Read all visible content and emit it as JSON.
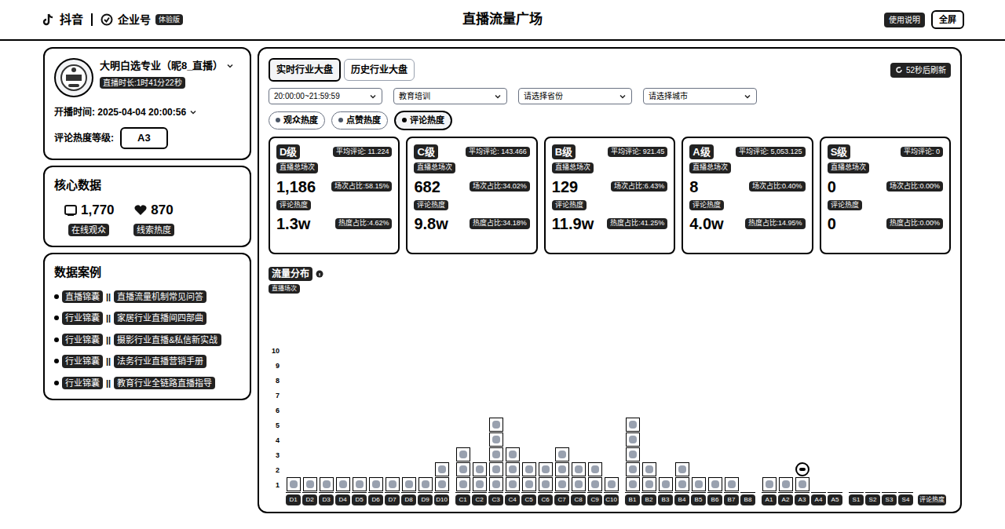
{
  "header": {
    "logo": "抖音",
    "brand": "企业号",
    "badge": "体验版",
    "title": "直播流量广场",
    "help": "使用说明",
    "fullscreen": "全屏"
  },
  "profile": {
    "name": "大明白选专业（昵8_直播）",
    "duration": "直播时长:1时41分22秒",
    "start": "开播时间: 2025-04-04 20:00:56",
    "level_label": "评论热度等级:",
    "level": "A3"
  },
  "core": {
    "title": "核心数据",
    "metrics": [
      {
        "value": "1,770",
        "label": "在线观众"
      },
      {
        "value": "870",
        "label": "线索热度"
      }
    ]
  },
  "cases": {
    "title": "数据案例",
    "items": [
      {
        "tag": "直播锦囊",
        "sep": "||",
        "text": "直播流量机制常见问答"
      },
      {
        "tag": "行业锦囊",
        "sep": "||",
        "text": "家居行业直播间四部曲"
      },
      {
        "tag": "行业锦囊",
        "sep": "||",
        "text": "摄影行业直播&私信新实战"
      },
      {
        "tag": "行业锦囊",
        "sep": "||",
        "text": "法务行业直播营销手册"
      },
      {
        "tag": "行业锦囊",
        "sep": "||",
        "text": "教育行业全链路直播指导"
      }
    ]
  },
  "main": {
    "tabs": [
      {
        "label": "实时行业大盘",
        "selected": true
      },
      {
        "label": "历史行业大盘",
        "selected": false
      }
    ],
    "refresh": "52秒后刷新",
    "filters": [
      "20:00:00~21:59:59",
      "教育培训",
      "请选择省份",
      "请选择城市"
    ],
    "metrics": [
      {
        "label": "观众热度",
        "selected": false
      },
      {
        "label": "点赞热度",
        "selected": false
      },
      {
        "label": "评论热度",
        "selected": true
      }
    ],
    "levels": [
      {
        "name": "D级",
        "avg": "平均评论: 11.224",
        "count_label": "直播总场次",
        "count": "1,186",
        "count_share": "场次占比:58.15%",
        "heat_label": "评论热度",
        "heat": "1.3w",
        "heat_share": "热度占比:4.62%"
      },
      {
        "name": "C级",
        "avg": "平均评论: 143.466",
        "count_label": "直播总场次",
        "count": "682",
        "count_share": "场次占比:34.02%",
        "heat_label": "评论热度",
        "heat": "9.8w",
        "heat_share": "热度占比:34.18%"
      },
      {
        "name": "B级",
        "avg": "平均评论: 921.45",
        "count_label": "直播总场次",
        "count": "129",
        "count_share": "场次占比:6.43%",
        "heat_label": "评论热度",
        "heat": "11.9w",
        "heat_share": "热度占比:41.25%"
      },
      {
        "name": "A级",
        "avg": "平均评论: 5,053.125",
        "count_label": "直播总场次",
        "count": "8",
        "count_share": "场次占比:0.40%",
        "heat_label": "评论热度",
        "heat": "4.0w",
        "heat_share": "热度占比:14.95%"
      },
      {
        "name": "S级",
        "avg": "平均评论: 0",
        "count_label": "直播总场次",
        "count": "0",
        "count_share": "场次占比:0.00%",
        "heat_label": "评论热度",
        "heat": "0",
        "heat_share": "热度占比:0.00%"
      }
    ]
  },
  "chart": {
    "title": "流量分布",
    "y_label": "直播场次",
    "y_ticks": [
      "10",
      "9",
      "8",
      "7",
      "6",
      "5",
      "4",
      "3",
      "2",
      "1"
    ],
    "x_end": "评论热度",
    "groups": [
      [
        {
          "label": "D1",
          "value": 1,
          "current": false
        },
        {
          "label": "D2",
          "value": 1,
          "current": false
        },
        {
          "label": "D3",
          "value": 1,
          "current": false
        },
        {
          "label": "D4",
          "value": 1,
          "current": false
        },
        {
          "label": "D5",
          "value": 1,
          "current": false
        },
        {
          "label": "D6",
          "value": 1,
          "current": false
        },
        {
          "label": "D7",
          "value": 1,
          "current": false
        },
        {
          "label": "D8",
          "value": 1,
          "current": false
        },
        {
          "label": "D9",
          "value": 1,
          "current": false
        },
        {
          "label": "D10",
          "value": 2,
          "current": false
        }
      ],
      [
        {
          "label": "C1",
          "value": 3,
          "current": false
        },
        {
          "label": "C2",
          "value": 2,
          "current": false
        },
        {
          "label": "C3",
          "value": 5,
          "current": false
        },
        {
          "label": "C4",
          "value": 3,
          "current": false
        },
        {
          "label": "C5",
          "value": 2,
          "current": false
        },
        {
          "label": "C6",
          "value": 2,
          "current": false
        },
        {
          "label": "C7",
          "value": 3,
          "current": false
        },
        {
          "label": "C8",
          "value": 2,
          "current": false
        },
        {
          "label": "C9",
          "value": 2,
          "current": false
        },
        {
          "label": "C10",
          "value": 1,
          "current": false
        }
      ],
      [
        {
          "label": "B1",
          "value": 5,
          "current": false
        },
        {
          "label": "B2",
          "value": 2,
          "current": false
        },
        {
          "label": "B3",
          "value": 1,
          "current": false
        },
        {
          "label": "B4",
          "value": 2,
          "current": false
        },
        {
          "label": "B5",
          "value": 1,
          "current": false
        },
        {
          "label": "B6",
          "value": 1,
          "current": false
        },
        {
          "label": "B7",
          "value": 1,
          "current": false
        },
        {
          "label": "B8",
          "value": 0,
          "current": false
        }
      ],
      [
        {
          "label": "A1",
          "value": 1,
          "current": false
        },
        {
          "label": "A2",
          "value": 1,
          "current": false
        },
        {
          "label": "A3",
          "value": 1,
          "current": true
        },
        {
          "label": "A4",
          "value": 0,
          "current": false
        },
        {
          "label": "A5",
          "value": 0,
          "current": false
        }
      ],
      [
        {
          "label": "S1",
          "value": 0,
          "current": false
        },
        {
          "label": "S2",
          "value": 0,
          "current": false
        },
        {
          "label": "S3",
          "value": 0,
          "current": false
        },
        {
          "label": "S4",
          "value": 0,
          "current": false
        }
      ]
    ]
  }
}
